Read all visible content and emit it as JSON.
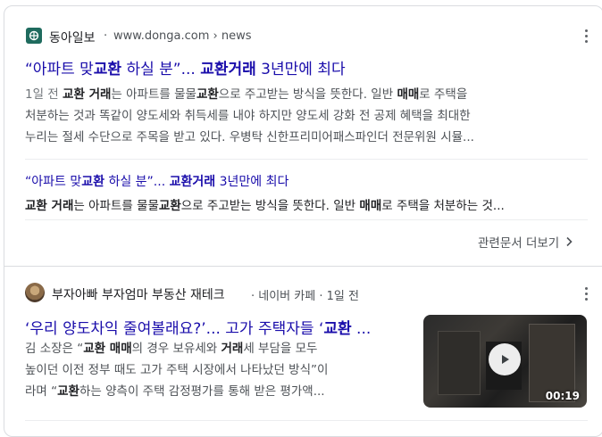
{
  "result1": {
    "source_name": "동아일보",
    "source_url": "www.donga.com › news",
    "icon": "donga-favicon",
    "title": {
      "p1": "“아파트 맞",
      "b1": "교환",
      "p2": " 하실 분”... ",
      "b2": "교환거래",
      "p3": " 3년만에 최다"
    },
    "snippet": {
      "date": "1일 전",
      "l1_pre": " ",
      "l1_b1": "교환 거래",
      "l1_p1": "는 아파트를 물물",
      "l1_b2": "교환",
      "l1_p2": "으로 주고받는 방식을 뜻한다. 일반 ",
      "l1_b3": "매매",
      "l1_p3": "로 주택을",
      "line2": "처분하는 것과 똑같이 양도세와 취득세를 내야 하지만 양도세 강화 전 공제 혜택을 최대한",
      "line3": "누리는 절세 수단으로 주목을 받고 있다. 우병탁 신한프리미어패스파인더 전문위원 시뮬..."
    },
    "sub": {
      "title": {
        "p1": "“아파트 맞",
        "b1": "교환",
        "p2": " 하실 분”... ",
        "b2": "교환거래",
        "p3": " 3년만에 최다"
      },
      "snippet": {
        "b1": "교환 거래",
        "p1": "는 아파트를 물물",
        "b2": "교환",
        "p2": "으로 주고받는 방식을 뜻한다. 일반 ",
        "b3": "매매",
        "p3": "로 주택을 처분하는 것..."
      }
    },
    "more_label": "관련문서 더보기"
  },
  "result2": {
    "source_name": "부자아빠 부자엄마 부동산 재테크",
    "source_meta": "· 네이버 카페 · 1일 전",
    "title": {
      "p1": "‘우리 양도차익 줄여볼래요?’... 고가 주택자들 ‘",
      "b1": "교환",
      "p2": " ..."
    },
    "snippet": {
      "l1_p1": "김 소장은 “",
      "l1_b1": "교환 매매",
      "l1_p2": "의 경우 보유세와 ",
      "l1_b2": "거래",
      "l1_p3": "세 부담을 모두",
      "line2": "높이던 이전 정부 때도 고가 주택 시장에서 나타났던 방식”이",
      "l3_p1": "라며 “",
      "l3_b1": "교환",
      "l3_p2": "하는 양측이 주택 감정평가를 통해 받은 평가액..."
    },
    "video_duration": "00:19"
  }
}
